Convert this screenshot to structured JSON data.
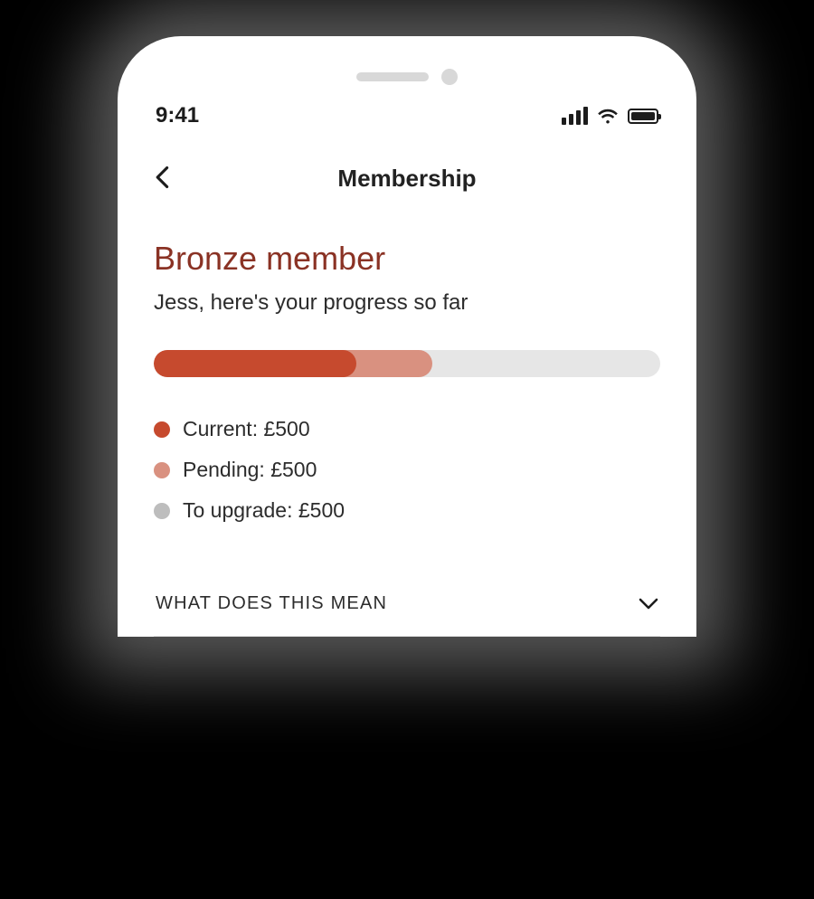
{
  "statusbar": {
    "time": "9:41"
  },
  "nav": {
    "title": "Membership"
  },
  "tier": {
    "title": "Bronze member",
    "subtitle": "Jess, here's your progress so far"
  },
  "progress": {
    "current_percent": 40,
    "pending_percent": 55,
    "legend": {
      "current": "Current: £500",
      "pending": "Pending: £500",
      "upgrade": "To upgrade: £500"
    }
  },
  "accordion": {
    "label": "WHAT DOES THIS MEAN"
  },
  "colors": {
    "accent": "#c64a2e",
    "accent_light": "#d99180",
    "track": "#e6e6e6",
    "tier_text": "#8a3224"
  }
}
